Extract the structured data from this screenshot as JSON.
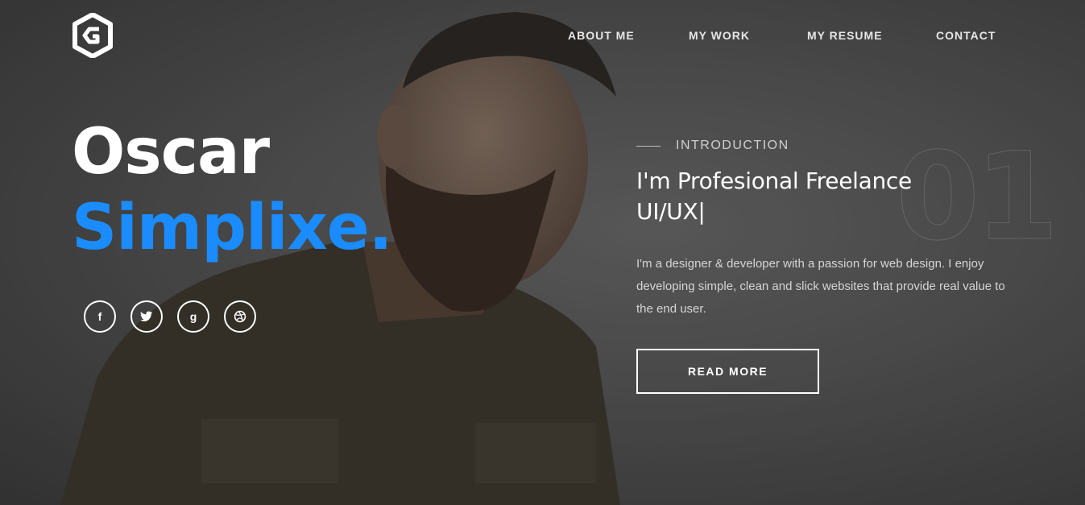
{
  "nav": {
    "items": [
      {
        "label": "ABOUT ME"
      },
      {
        "label": "MY WORK"
      },
      {
        "label": "MY RESUME"
      },
      {
        "label": "CONTACT"
      }
    ]
  },
  "hero": {
    "first_name": "Oscar",
    "last_name": "Simplixe.",
    "accent_color": "#1a8cff",
    "social": [
      {
        "icon": "facebook-icon",
        "glyph": "f"
      },
      {
        "icon": "twitter-icon",
        "glyph": "t"
      },
      {
        "icon": "google-icon",
        "glyph": "g"
      },
      {
        "icon": "dribbble-icon",
        "glyph": "d"
      }
    ]
  },
  "intro": {
    "label": "INTRODUCTION",
    "number": "01",
    "headline": "I'm Profesional Freelance UI/UX|",
    "description": "I'm a designer & developer with a passion for web design. I enjoy developing simple, clean and slick websites that provide real value to the end user.",
    "button_label": "READ MORE"
  }
}
